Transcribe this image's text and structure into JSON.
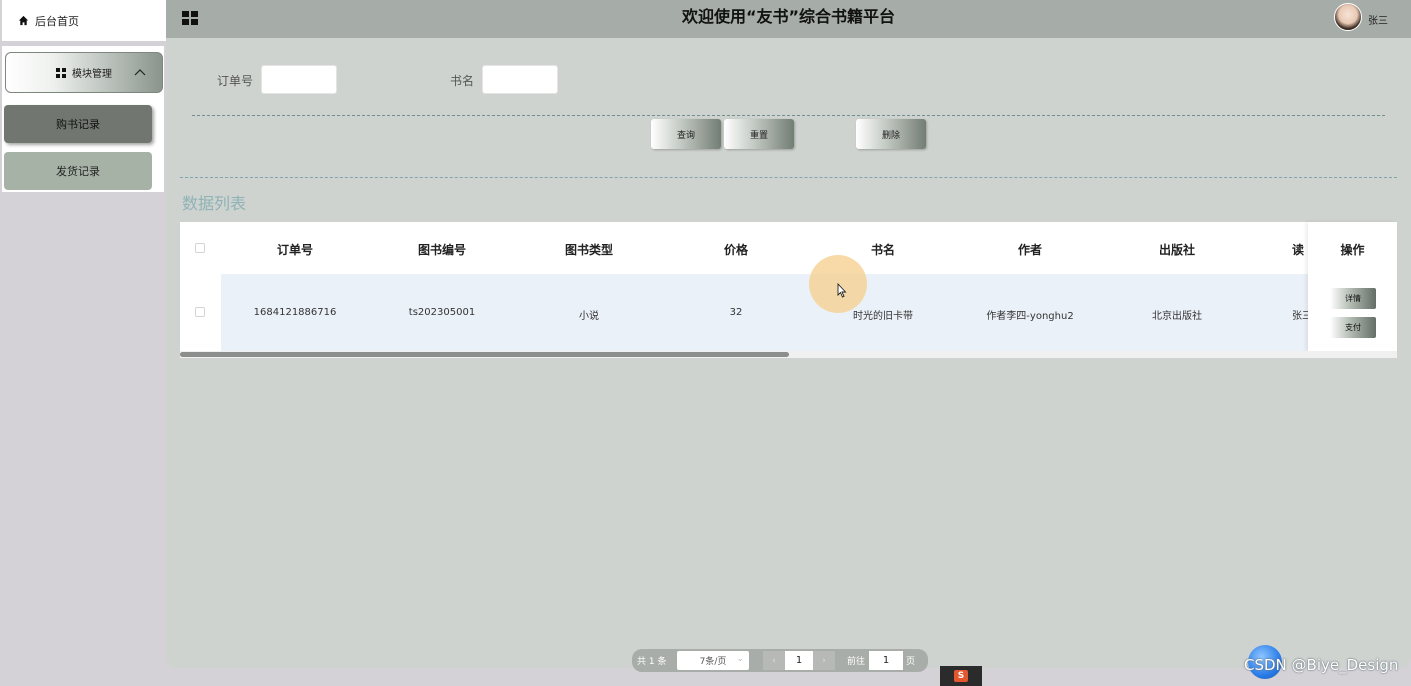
{
  "sidebar": {
    "home_label": "后台首页",
    "module_label": "模块管理",
    "items": [
      {
        "label": "购书记录"
      },
      {
        "label": "发货记录"
      }
    ]
  },
  "header": {
    "title": "欢迎使用“友书”综合书籍平台",
    "username": "张三"
  },
  "search": {
    "order_label": "订单号",
    "order_value": "",
    "bookname_label": "书名",
    "bookname_value": ""
  },
  "actions": {
    "query": "查询",
    "reset": "重置",
    "delete": "删除"
  },
  "section_title": "数据列表",
  "table": {
    "columns": [
      "订单号",
      "图书编号",
      "图书类型",
      "价格",
      "书名",
      "作者",
      "出版社",
      "读"
    ],
    "op_header": "操作",
    "rows": [
      {
        "cells": [
          "1684121886716",
          "ts202305001",
          "小说",
          "32",
          "时光的旧卡带",
          "作者李四-yonghu2",
          "北京出版社",
          "张三"
        ],
        "ops": [
          "详情",
          "支付"
        ]
      }
    ],
    "scroll_fraction": 0.5
  },
  "pagination": {
    "total": "共 1 条",
    "page_size": "7条/页",
    "prev": "‹",
    "current_page": "1",
    "next": "›",
    "goto_label": "前往",
    "goto_value": "1",
    "page_suffix": "页"
  },
  "watermark": "CSDN @Biye_Design",
  "icons": {
    "home": "home-icon",
    "grid": "grid-icon",
    "chevron": "chevron-up-icon",
    "cursor": "mouse-pointer-icon"
  },
  "colors": {
    "header_bg": "#a6aca8",
    "main_bg": "#cfd3cf",
    "sidebar_active": "#717770",
    "sidebar_item": "#a7b2a7",
    "section_title": "#8fb2b6",
    "row_band": "#ebf1f8"
  }
}
